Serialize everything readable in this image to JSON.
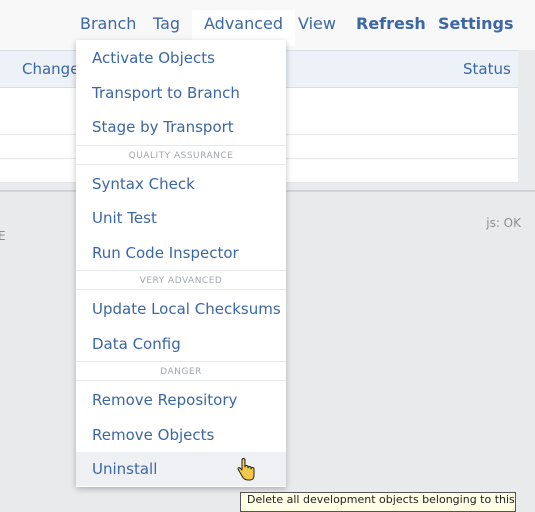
{
  "nav": {
    "branch": "Branch",
    "tag": "Tag",
    "advanced": "Advanced",
    "view": "View",
    "refresh": "Refresh",
    "settings": "Settings"
  },
  "table": {
    "col_changed": "Changed",
    "col_status": "Status"
  },
  "lower": {
    "left_fragment": "E",
    "js_status": "js: OK"
  },
  "menu": {
    "activate_objects": "Activate Objects",
    "transport_to_branch": "Transport to Branch",
    "stage_by_transport": "Stage by Transport",
    "section_qa": "QUALITY ASSURANCE",
    "syntax_check": "Syntax Check",
    "unit_test": "Unit Test",
    "run_code_inspector": "Run Code Inspector",
    "section_very_advanced": "VERY ADVANCED",
    "update_local_checksums": "Update Local Checksums",
    "data_config": "Data Config",
    "section_danger": "DANGER",
    "remove_repository": "Remove Repository",
    "remove_objects": "Remove Objects",
    "uninstall": "Uninstall"
  },
  "tooltip": "Delete all development objects belonging to this"
}
